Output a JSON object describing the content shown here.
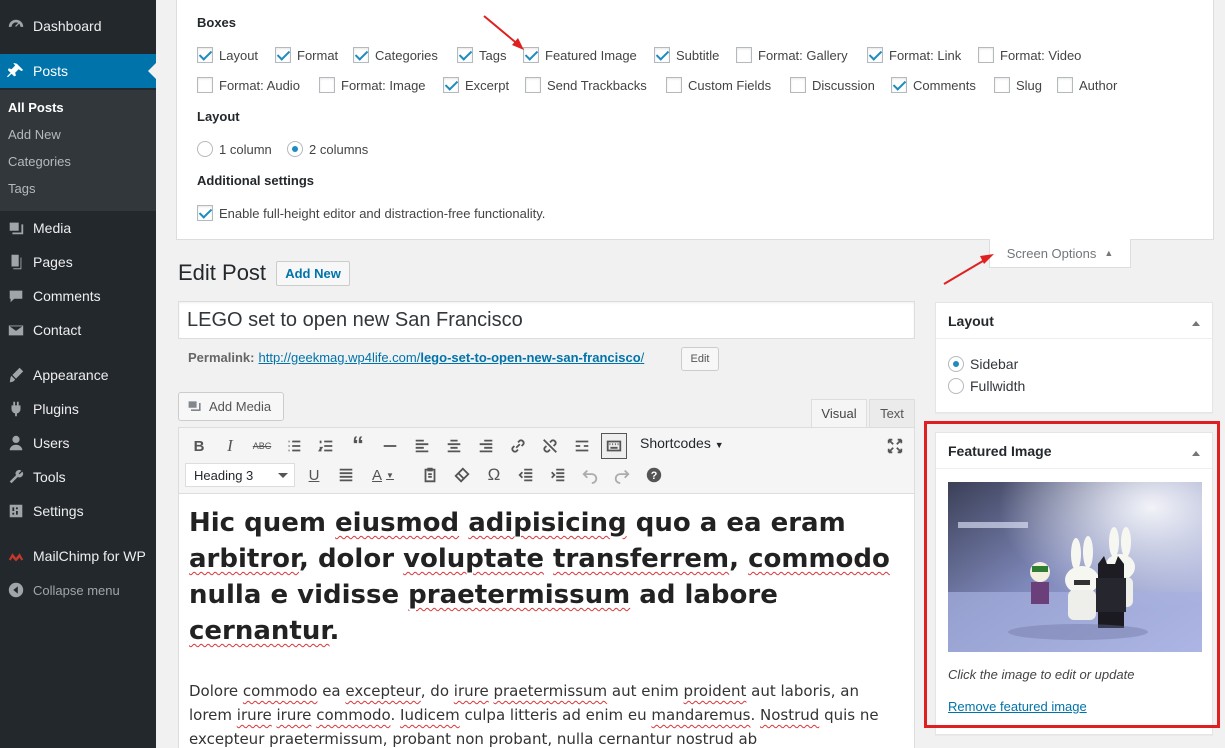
{
  "sidebar": {
    "items": [
      {
        "label": "Dashboard",
        "icon": "dashboard-icon"
      },
      {
        "label": "Posts",
        "icon": "pin-icon"
      },
      {
        "label": "Media",
        "icon": "media-icon"
      },
      {
        "label": "Pages",
        "icon": "pages-icon"
      },
      {
        "label": "Comments",
        "icon": "comments-icon"
      },
      {
        "label": "Contact",
        "icon": "mail-icon"
      },
      {
        "label": "Appearance",
        "icon": "brush-icon"
      },
      {
        "label": "Plugins",
        "icon": "plugin-icon"
      },
      {
        "label": "Users",
        "icon": "user-icon"
      },
      {
        "label": "Tools",
        "icon": "wrench-icon"
      },
      {
        "label": "Settings",
        "icon": "settings-icon"
      },
      {
        "label": "MailChimp for WP",
        "icon": "mailchimp-icon"
      },
      {
        "label": "Collapse menu",
        "icon": "collapse-icon"
      }
    ],
    "submenu": [
      "All Posts",
      "Add New",
      "Categories",
      "Tags"
    ]
  },
  "screen_options": {
    "boxes_heading": "Boxes",
    "boxes_row1": [
      {
        "label": "Layout",
        "checked": true
      },
      {
        "label": "Format",
        "checked": true
      },
      {
        "label": "Categories",
        "checked": true
      },
      {
        "label": "Tags",
        "checked": true
      },
      {
        "label": "Featured Image",
        "checked": true
      },
      {
        "label": "Subtitle",
        "checked": true
      },
      {
        "label": "Format: Gallery",
        "checked": false
      },
      {
        "label": "Format: Link",
        "checked": true
      },
      {
        "label": "Format: Video",
        "checked": false
      }
    ],
    "boxes_row2": [
      {
        "label": "Format: Audio",
        "checked": false
      },
      {
        "label": "Format: Image",
        "checked": false
      },
      {
        "label": "Excerpt",
        "checked": true
      },
      {
        "label": "Send Trackbacks",
        "checked": false
      },
      {
        "label": "Custom Fields",
        "checked": false
      },
      {
        "label": "Discussion",
        "checked": false
      },
      {
        "label": "Comments",
        "checked": true
      },
      {
        "label": "Slug",
        "checked": false
      },
      {
        "label": "Author",
        "checked": false
      }
    ],
    "layout_heading": "Layout",
    "layout_options": [
      {
        "label": "1 column",
        "selected": false
      },
      {
        "label": "2 columns",
        "selected": true
      }
    ],
    "additional_heading": "Additional settings",
    "additional_option": {
      "label": "Enable full-height editor and distraction-free functionality.",
      "checked": true
    },
    "tab_label": "Screen Options"
  },
  "page": {
    "title": "Edit Post",
    "add_new": "Add New",
    "post_title": "LEGO set to open new San Francisco",
    "permalink_label": "Permalink:",
    "permalink_base": "http://geekmag.wp4life.com/",
    "permalink_slug": "lego-set-to-open-new-san-francisco",
    "permalink_end": "/",
    "edit_label": "Edit",
    "add_media": "Add Media",
    "tab_visual": "Visual",
    "tab_text": "Text",
    "shortcodes": "Shortcodes",
    "format_select": "Heading 3"
  },
  "content": {
    "heading_parts": [
      "Hic quem ",
      "eiusmod",
      " ",
      "adipisicing",
      " quo a ea eram ",
      "arbitror",
      ", dolor ",
      "voluptate",
      " ",
      "transferrem",
      ", ",
      "commodo",
      " nulla e vidisse ",
      "praetermissum",
      " ad labore ",
      "cernantur",
      "."
    ],
    "paragraph_parts": [
      "Dolore ",
      "commodo",
      " ea ",
      "excepteur",
      ", do ",
      "irure",
      " ",
      "praetermissum",
      " aut enim ",
      "proident",
      " aut laboris, an lorem ",
      "irure",
      " ",
      "irure",
      " ",
      "commodo",
      ". ",
      "Iudicem",
      " culpa litteris ad enim eu ",
      "mandaremus",
      ". ",
      "Nostrud",
      " quis ne ",
      "excepteur",
      " ",
      "praetermissum",
      ", probant non probant, nulla ",
      "cernantur",
      " ",
      "nostrud",
      " ab"
    ]
  },
  "layout_box": {
    "title": "Layout",
    "options": [
      {
        "label": "Sidebar",
        "selected": true
      },
      {
        "label": "Fullwidth",
        "selected": false
      }
    ]
  },
  "featured_image_box": {
    "title": "Featured Image",
    "caption": "Click the image to edit or update",
    "remove_link": "Remove featured image"
  },
  "colors": {
    "admin_bar": "#23282d",
    "accent": "#0073aa",
    "highlight": "#e02020"
  }
}
